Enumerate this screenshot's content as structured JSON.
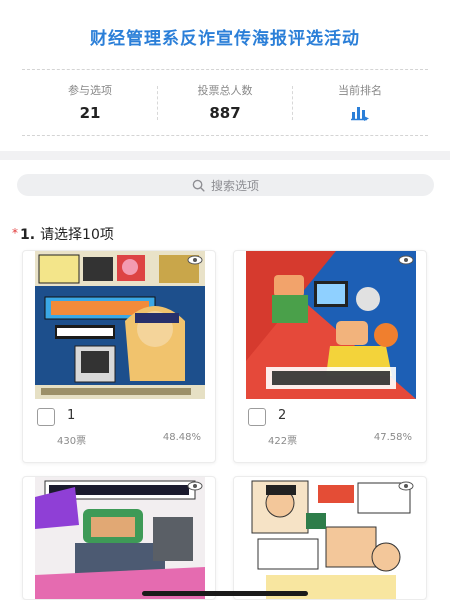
{
  "page": {
    "title": "财经管理系反诈宣传海报评选活动"
  },
  "stats": {
    "options": {
      "label": "参与选项",
      "value": "21"
    },
    "votes": {
      "label": "投票总人数",
      "value": "887"
    },
    "rank": {
      "label": "当前排名",
      "icon": "bar-chart-arrow-icon"
    }
  },
  "search": {
    "placeholder": "搜索选项",
    "icon": "search-icon"
  },
  "question": {
    "required_mark": "*",
    "number": "1.",
    "text": "请选择10项"
  },
  "options": [
    {
      "label": "1",
      "votes": "430票",
      "percent": "48.48%",
      "image": "anti-fraud-poster-1"
    },
    {
      "label": "2",
      "votes": "422票",
      "percent": "47.58%",
      "image": "anti-fraud-poster-2"
    },
    {
      "label": "",
      "votes": "",
      "percent": "",
      "image": "anti-fraud-poster-3"
    },
    {
      "label": "",
      "votes": "",
      "percent": "",
      "image": "anti-fraud-poster-4"
    }
  ],
  "colors": {
    "accent": "#2b7fd8",
    "required": "#e23b3b",
    "muted": "#8a8a8a"
  }
}
